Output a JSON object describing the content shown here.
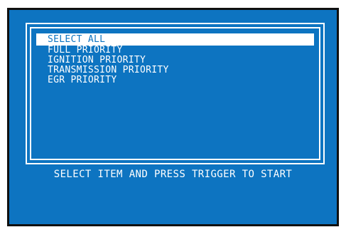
{
  "menu": {
    "items": [
      {
        "label": "SELECT ALL",
        "selected": true
      },
      {
        "label": "FULL PRIORITY",
        "selected": false
      },
      {
        "label": "IGNITION PRIORITY",
        "selected": false
      },
      {
        "label": "TRANSMISSION PRIORITY",
        "selected": false
      },
      {
        "label": "EGR PRIORITY",
        "selected": false
      }
    ]
  },
  "status": {
    "instruction": "SELECT ITEM AND PRESS TRIGGER TO START"
  },
  "colors": {
    "screen_background": "#0d74c1",
    "text": "#ffffff",
    "highlight_background": "#ffffff",
    "bezel": "#101010"
  }
}
